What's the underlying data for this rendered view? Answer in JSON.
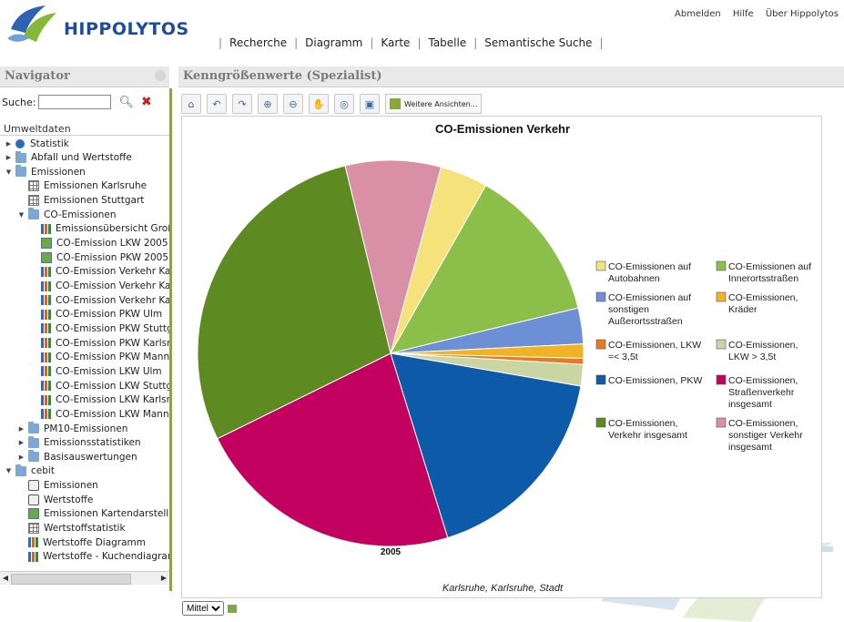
{
  "header": {
    "logo_text": "HIPPOLYTOS",
    "top_links": [
      "Abmelden",
      "Hilfe",
      "Über Hippolytos"
    ],
    "main_nav": [
      "Recherche",
      "Diagramm",
      "Karte",
      "Tabelle",
      "Semantische Suche"
    ]
  },
  "navigator": {
    "title": "Navigator",
    "search_label": "Suche:",
    "search_value": "",
    "root_label": "Umweltdaten",
    "items": [
      {
        "label": "Statistik",
        "icon": "info-icon",
        "level": 1,
        "toggle": "collapsed"
      },
      {
        "label": "Abfall und Wertstoffe",
        "icon": "folder-icon",
        "level": 1,
        "toggle": "collapsed"
      },
      {
        "label": "Emissionen",
        "icon": "folder-icon",
        "level": 1,
        "toggle": "expanded"
      },
      {
        "label": "Emissionen Karlsruhe",
        "icon": "table-icon",
        "level": 2,
        "toggle": ""
      },
      {
        "label": "Emissionen Stuttgart",
        "icon": "table-icon",
        "level": 2,
        "toggle": ""
      },
      {
        "label": "CO-Emissionen",
        "icon": "folder-icon",
        "level": 2,
        "toggle": "expanded"
      },
      {
        "label": "Emissionsübersicht Großs",
        "icon": "chart-icon",
        "level": 3,
        "toggle": ""
      },
      {
        "label": "CO-Emission LKW 2005",
        "icon": "map-icon",
        "level": 3,
        "toggle": ""
      },
      {
        "label": "CO-Emission PKW 2005",
        "icon": "map-icon",
        "level": 3,
        "toggle": ""
      },
      {
        "label": "CO-Emission Verkehr Kar",
        "icon": "chart-icon",
        "level": 3,
        "toggle": ""
      },
      {
        "label": "CO-Emission Verkehr Kar",
        "icon": "chart-icon",
        "level": 3,
        "toggle": ""
      },
      {
        "label": "CO-Emission Verkehr Kar",
        "icon": "chart-icon",
        "level": 3,
        "toggle": ""
      },
      {
        "label": "CO-Emission PKW Ulm",
        "icon": "chart-icon",
        "level": 3,
        "toggle": ""
      },
      {
        "label": "CO-Emission PKW Stuttg",
        "icon": "chart-icon",
        "level": 3,
        "toggle": ""
      },
      {
        "label": "CO-Emission PKW Karlsru",
        "icon": "chart-icon",
        "level": 3,
        "toggle": ""
      },
      {
        "label": "CO-Emission PKW Mannh",
        "icon": "chart-icon",
        "level": 3,
        "toggle": ""
      },
      {
        "label": "CO-Emission LKW Ulm",
        "icon": "chart-icon",
        "level": 3,
        "toggle": ""
      },
      {
        "label": "CO-Emission LKW Stuttg",
        "icon": "chart-icon",
        "level": 3,
        "toggle": ""
      },
      {
        "label": "CO-Emission LKW Karlsru",
        "icon": "chart-icon",
        "level": 3,
        "toggle": ""
      },
      {
        "label": "CO-Emission LKW Mannh",
        "icon": "chart-icon",
        "level": 3,
        "toggle": ""
      },
      {
        "label": "PM10-Emissionen",
        "icon": "folder-icon",
        "level": 2,
        "toggle": "collapsed"
      },
      {
        "label": "Emissionsstatistiken",
        "icon": "folder-icon",
        "level": 2,
        "toggle": "collapsed"
      },
      {
        "label": "Basisauswertungen",
        "icon": "folder-icon",
        "level": 2,
        "toggle": "collapsed"
      },
      {
        "label": "cebit",
        "icon": "folder-icon",
        "level": 1,
        "toggle": "expanded"
      },
      {
        "label": "Emissionen",
        "icon": "analysis-icon",
        "level": 2,
        "toggle": ""
      },
      {
        "label": "Wertstoffe",
        "icon": "analysis-icon",
        "level": 2,
        "toggle": ""
      },
      {
        "label": "Emissionen Kartendarstellun",
        "icon": "map-icon",
        "level": 2,
        "toggle": ""
      },
      {
        "label": "Wertstoffstatistik",
        "icon": "table-icon",
        "level": 2,
        "toggle": ""
      },
      {
        "label": "Wertstoffe Diagramm",
        "icon": "chart-icon",
        "level": 2,
        "toggle": ""
      },
      {
        "label": "Wertstoffe - Kuchendiagram",
        "icon": "chart-icon",
        "level": 2,
        "toggle": ""
      }
    ]
  },
  "panel": {
    "title": "Kenngrößenwerte (Spezialist)",
    "toolbar_icons": [
      "home-icon",
      "undo-icon",
      "redo-icon",
      "zoom-in-icon",
      "zoom-out-icon",
      "pan-hand-icon",
      "globe-icon",
      "save-icon"
    ],
    "more_views_label": "Weitere Ansichten...",
    "size_select": "Mittel"
  },
  "chart_data": {
    "type": "pie",
    "title": "CO-Emissionen Verkehr",
    "category_label": "2005",
    "footer": "Karlsruhe, Karlsruhe, Stadt",
    "legend_position": "right",
    "series": [
      {
        "name": "CO-Emissionen auf Autobahnen",
        "value": 4.0,
        "color": "#f5e27a"
      },
      {
        "name": "CO-Emissionen auf Innerortsstraßen",
        "value": 13.0,
        "color": "#8cbf4a"
      },
      {
        "name": "CO-Emissionen auf sonstigen Außerortsstraßen",
        "value": 3.0,
        "color": "#6d8fd6"
      },
      {
        "name": "CO-Emissionen, Kräder",
        "value": 1.2,
        "color": "#f0b323"
      },
      {
        "name": "CO-Emissionen, LKW =< 3,5t",
        "value": 0.5,
        "color": "#e87a22"
      },
      {
        "name": "CO-Emissionen, LKW > 3,5t",
        "value": 1.8,
        "color": "#c9d6a4"
      },
      {
        "name": "CO-Emissionen, PKW",
        "value": 17.5,
        "color": "#0d5aa8"
      },
      {
        "name": "CO-Emissionen, Straßenverkehr insgesamt",
        "value": 22.5,
        "color": "#c2005f"
      },
      {
        "name": "CO-Emissionen, Verkehr insgesamt",
        "value": 28.5,
        "color": "#5e8a22"
      },
      {
        "name": "CO-Emissionen, sonstiger Verkehr insgesamt",
        "value": 8.0,
        "color": "#d98fa6"
      }
    ],
    "legend_lines": [
      [
        "CO-Emissionen auf",
        "Autobahnen"
      ],
      [
        "CO-Emissionen auf",
        "Innerortsstraßen"
      ],
      [
        "CO-Emissionen auf",
        "sonstigen",
        "Außerortsstraßen"
      ],
      [
        "CO-Emissionen,",
        "Kräder"
      ],
      [
        "CO-Emissionen, LKW",
        "=< 3,5t"
      ],
      [
        "CO-Emissionen,",
        "LKW > 3,5t"
      ],
      [
        "CO-Emissionen, PKW"
      ],
      [
        "CO-Emissionen,",
        "Straßenverkehr",
        "insgesamt"
      ],
      [
        "CO-Emissionen,",
        "Verkehr insgesamt"
      ],
      [
        "CO-Emissionen,",
        "sonstiger Verkehr",
        "insgesamt"
      ]
    ]
  }
}
